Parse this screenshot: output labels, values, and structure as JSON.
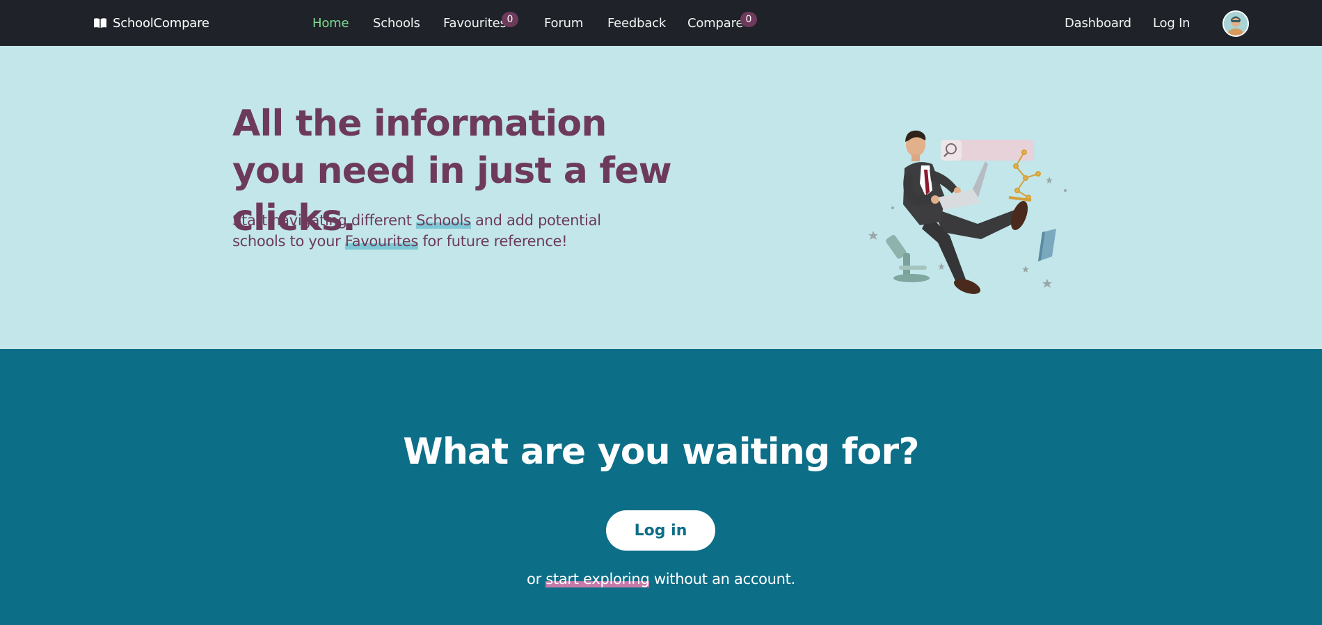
{
  "navbar": {
    "brand": "SchoolCompare",
    "links": {
      "home": "Home",
      "schools": "Schools",
      "favourites": "Favourites",
      "forum": "Forum",
      "feedback": "Feedback",
      "compare": "Compare"
    },
    "favourites_count": "0",
    "compare_count": "0",
    "dashboard": "Dashboard",
    "login": "Log In"
  },
  "hero": {
    "title": "All the information you need in just a few clicks.",
    "text_before": "Start navigating different ",
    "schools_link": "Schools",
    "text_middle": " and add potential schools to your ",
    "favourites_link": "Favourites",
    "text_after": " for future reference!"
  },
  "cta": {
    "title": "What are you waiting for?",
    "login_button": "Log in",
    "text_before": "or ",
    "explore_link": "start exploring",
    "text_after": " without an account."
  },
  "colors": {
    "navbar_bg": "#1f2329",
    "hero_bg": "#c2e6e9",
    "brand_purple": "#6d3a5b",
    "cta_bg": "#0d6e87",
    "active_link": "#7ddc8f"
  },
  "icons": {
    "brand": "book-open-icon",
    "avatar": "user-avatar-icon"
  }
}
